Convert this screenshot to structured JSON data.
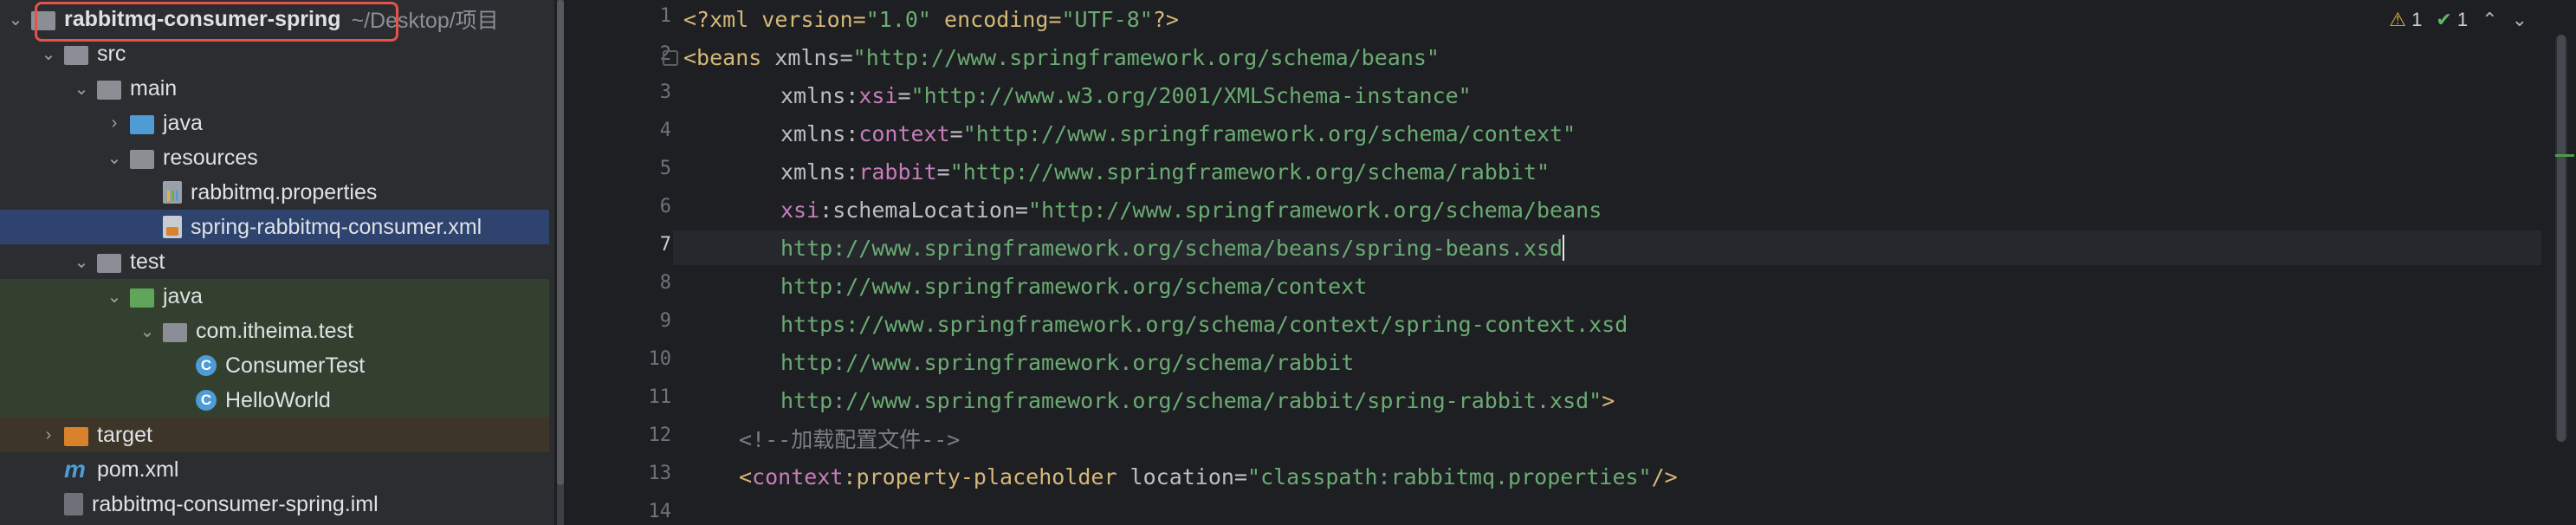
{
  "project_tree": {
    "root": {
      "name": "rabbitmq-consumer-spring",
      "path_hint": "~/Desktop/项目"
    },
    "items": [
      {
        "label": "src",
        "icon": "folder-icon"
      },
      {
        "label": "main",
        "icon": "folder-icon"
      },
      {
        "label": "java",
        "icon": "source-folder-icon"
      },
      {
        "label": "resources",
        "icon": "resources-folder-icon"
      },
      {
        "label": "rabbitmq.properties",
        "icon": "properties-file-icon"
      },
      {
        "label": "spring-rabbitmq-consumer.xml",
        "icon": "xml-file-icon"
      },
      {
        "label": "test",
        "icon": "folder-icon"
      },
      {
        "label": "java",
        "icon": "test-folder-icon"
      },
      {
        "label": "com.itheima.test",
        "icon": "package-icon"
      },
      {
        "label": "ConsumerTest",
        "icon": "class-icon"
      },
      {
        "label": "HelloWorld",
        "icon": "class-icon"
      },
      {
        "label": "target",
        "icon": "excluded-folder-icon"
      },
      {
        "label": "pom.xml",
        "icon": "maven-icon"
      },
      {
        "label": "rabbitmq-consumer-spring.iml",
        "icon": "iml-file-icon"
      }
    ],
    "selected": "spring-rabbitmq-consumer.xml"
  },
  "editor": {
    "current_line": 7,
    "line_numbers": [
      "1",
      "2",
      "3",
      "4",
      "5",
      "6",
      "7",
      "8",
      "9",
      "10",
      "11",
      "12",
      "13",
      "14"
    ],
    "lines": {
      "l1": {
        "p1": "<?xml version=",
        "p2": "\"1.0\"",
        "p3": " encoding=",
        "p4": "\"UTF-8\"",
        "p5": "?>"
      },
      "l2": {
        "tag": "<beans",
        "attr": " xmlns=",
        "val": "\"http://www.springframework.org/schema/beans\""
      },
      "l3": {
        "attr1": "xmlns:",
        "ns": "xsi",
        "attr2": "=",
        "val": "\"http://www.w3.org/2001/XMLSchema-instance\""
      },
      "l4": {
        "attr1": "xmlns:",
        "ns": "context",
        "attr2": "=",
        "val": "\"http://www.springframework.org/schema/context\""
      },
      "l5": {
        "attr1": "xmlns:",
        "ns": "rabbit",
        "attr2": "=",
        "val": "\"http://www.springframework.org/schema/rabbit\""
      },
      "l6": {
        "ns": "xsi",
        "attr": ":schemaLocation=",
        "val": "\"http://www.springframework.org/schema/beans"
      },
      "l7": {
        "val": "http://www.springframework.org/schema/beans/spring-beans.xsd"
      },
      "l8": {
        "val": "http://www.springframework.org/schema/context"
      },
      "l9": {
        "val": "https://www.springframework.org/schema/context/spring-context.xsd"
      },
      "l10": {
        "val": "http://www.springframework.org/schema/rabbit"
      },
      "l11": {
        "val": "http://www.springframework.org/schema/rabbit/spring-rabbit.xsd\"",
        "end": ">"
      },
      "l12": {
        "comment": "<!--加载配置文件-->"
      },
      "l13": {
        "open": "<",
        "ns": "context",
        "tag": ":property-placeholder",
        "attr": " location=",
        "val": "\"classpath:rabbitmq.properties\"",
        "close": "/>"
      }
    }
  },
  "inspections": {
    "warnings": "1",
    "ok": "1"
  },
  "colors": {
    "accent_selection": "#2e436e",
    "highlight_box": "#e5534b",
    "string": "#6aab73",
    "tag": "#d5b778",
    "namespace": "#c77dbb"
  }
}
